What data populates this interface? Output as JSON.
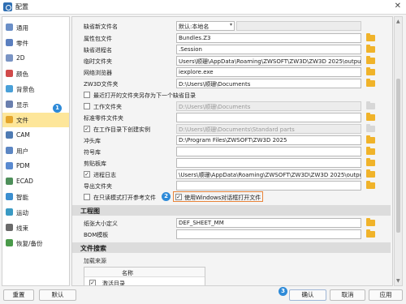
{
  "window": {
    "title": "配置",
    "close_glyph": "✕"
  },
  "sidebar": {
    "items": [
      {
        "label": "通用",
        "icon": "general-icon",
        "color": "#6b8fc7"
      },
      {
        "label": "零件",
        "icon": "part-icon",
        "color": "#5b7fbf"
      },
      {
        "label": "2D",
        "icon": "2d-icon",
        "color": "#7a94c4"
      },
      {
        "label": "颜色",
        "icon": "color-icon",
        "color": "#d14a4a"
      },
      {
        "label": "背景色",
        "icon": "background-color-icon",
        "color": "#4aa0d8"
      },
      {
        "label": "显示",
        "icon": "display-icon",
        "color": "#6a7fae"
      },
      {
        "label": "文件",
        "icon": "file-icon",
        "color": "#e4a52c",
        "selected": true
      },
      {
        "label": "CAM",
        "icon": "cam-icon",
        "color": "#4f7bb3"
      },
      {
        "label": "用户",
        "icon": "user-icon",
        "color": "#5c86c3"
      },
      {
        "label": "PDM",
        "icon": "pdm-icon",
        "color": "#5a8ad0"
      },
      {
        "label": "ECAD",
        "icon": "ecad-icon",
        "color": "#4e8f5a"
      },
      {
        "label": "智能",
        "icon": "smart-icon",
        "color": "#3c8fd0"
      },
      {
        "label": "运动",
        "icon": "motion-icon",
        "color": "#3a9ac4"
      },
      {
        "label": "线束",
        "icon": "harness-icon",
        "color": "#6a6a6a"
      },
      {
        "label": "恢复/备份",
        "icon": "restore-backup-icon",
        "color": "#4a9a4a"
      }
    ]
  },
  "badges": {
    "b1": "1",
    "b2": "2",
    "b3": "3"
  },
  "settings": {
    "default_filename": {
      "label": "缺省新文件名",
      "value": "默认:本地名"
    },
    "attribute_file": {
      "label": "属性包文件",
      "value": "Bundles.Z3"
    },
    "default_session": {
      "label": "缺省进程名",
      "value": ".Session"
    },
    "temp_folder": {
      "label": "临时文件夹",
      "value": "Users\\顺珊\\AppData\\Roaming\\ZWSOFT\\ZW3D\\ZW3D 2025\\output\\temp"
    },
    "browser": {
      "label": "网络浏览器",
      "value": "iexplore.exe"
    },
    "zw3d_folder": {
      "label": "ZW3D文件夹",
      "value": "D:\\Users\\顺珊\\Documents"
    },
    "last_folder": {
      "label": "最近打开的文件夹另存为下一个缺省目录",
      "checked": false
    },
    "work_folder": {
      "label": "工作文件夹",
      "value": "D:\\Users\\顺珊\\Documents",
      "checked": false
    },
    "std_parts_folder": {
      "label": "标准零件文件夹",
      "value": ""
    },
    "create_instance": {
      "label": "在工作目录下创建实例",
      "value": "D:\\Users\\顺珊\\Documents\\Standard parts",
      "checked": true
    },
    "punch_lib": {
      "label": "冲头库",
      "value": "D:\\Program Files\\ZWSOFT\\ZW3D 2025"
    },
    "symbol_lib": {
      "label": "符号库",
      "value": ""
    },
    "clip_lib": {
      "label": "剪贴板库",
      "value": ""
    },
    "process_log": {
      "label": "进程日志",
      "value": "\\Users\\顺珊\\AppData\\Roaming\\ZWSOFT\\ZW3D\\ZW3D 2025\\output\\logs",
      "checked": true
    },
    "export_folder": {
      "label": "导出文件夹",
      "value": ""
    },
    "collab_open": {
      "label": "在只读模式打开参考文件",
      "checked": false
    },
    "windows_dialog": {
      "label": "使用Windows对话框打开文件",
      "checked": true
    }
  },
  "drawing": {
    "section_label": "工程图",
    "paper_size": {
      "label": "纸张大小定义",
      "value": "DEF_SHEET_MM"
    },
    "bom_template": {
      "label": "BOM模板",
      "value": ""
    }
  },
  "file_search": {
    "section_label": "文件搜索",
    "group_label": "加载来源",
    "table_header": "名称",
    "rows": [
      {
        "text": "激活目录",
        "checked": true
      }
    ]
  },
  "buttons": {
    "reset": "重置",
    "default": "默认",
    "ok": "确认",
    "cancel": "取消",
    "apply": "应用"
  }
}
